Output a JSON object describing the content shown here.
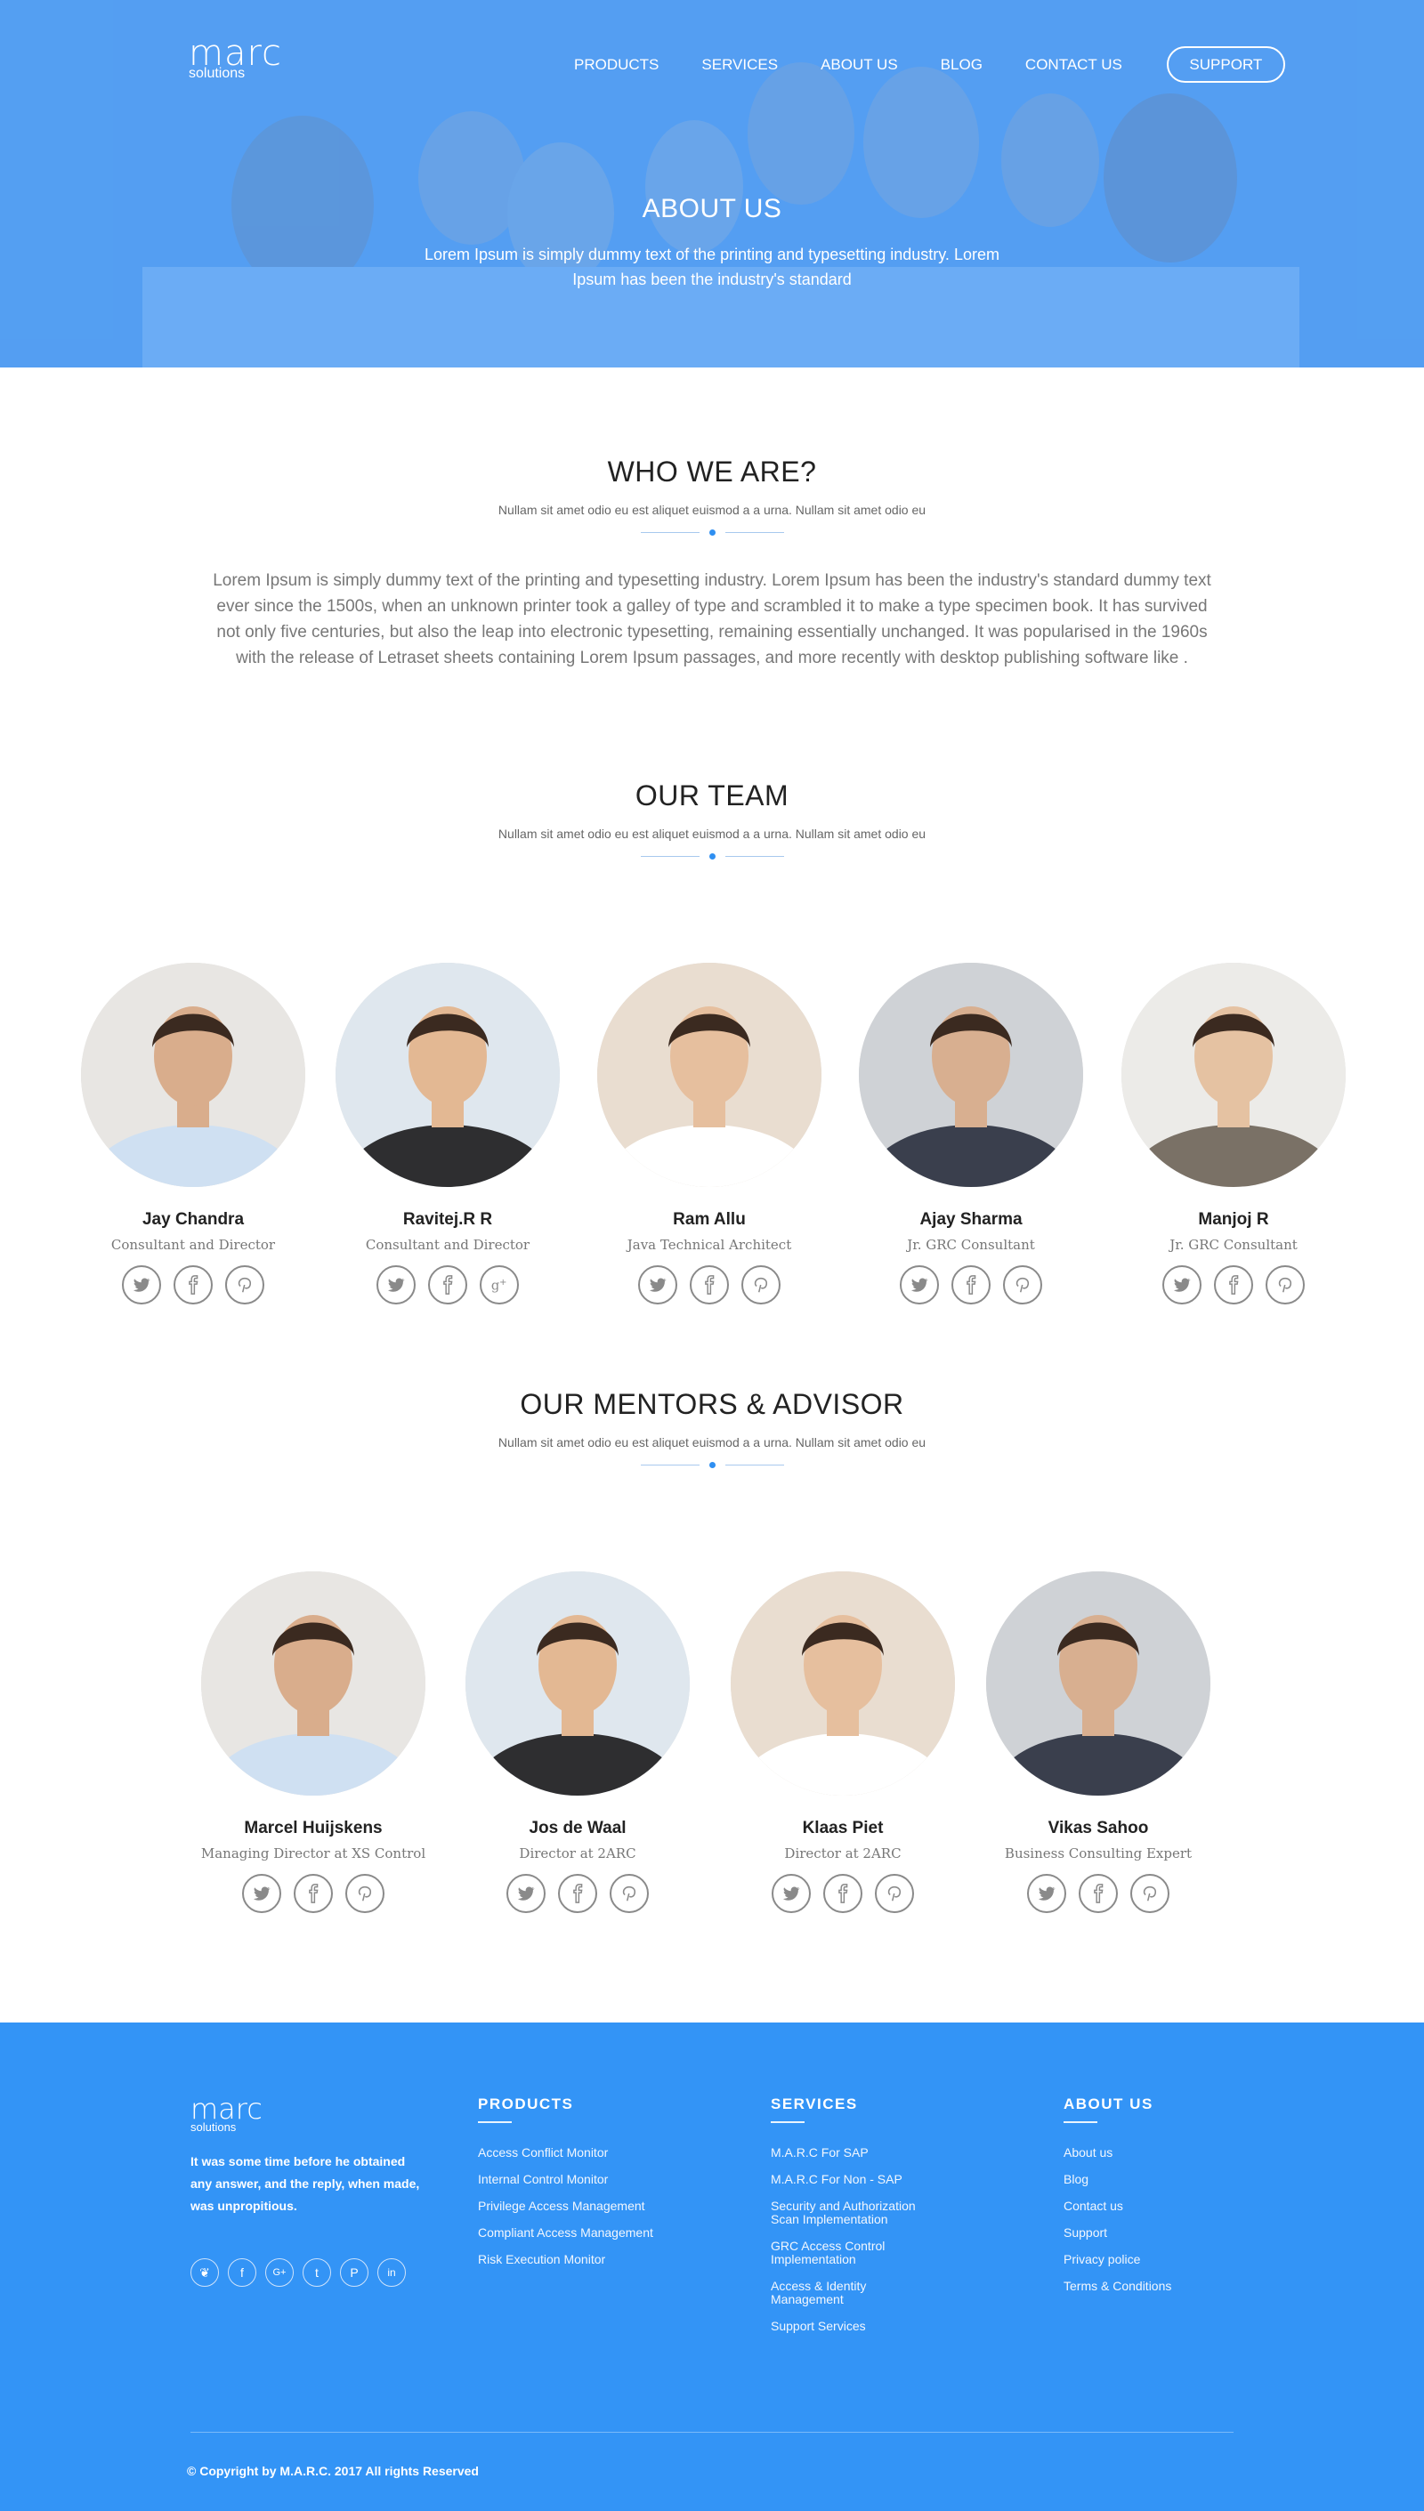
{
  "header": {
    "logo_word": "marc",
    "logo_sub": "solutions",
    "nav": [
      "PRODUCTS",
      "SERVICES",
      "ABOUT US",
      "BLOG",
      "CONTACT US"
    ],
    "support_label": "SUPPORT"
  },
  "hero": {
    "title": "ABOUT US",
    "subtitle": "Lorem Ipsum is simply dummy text of the printing and typesetting industry. Lorem Ipsum has been the industry's standard"
  },
  "who": {
    "title": "WHO WE ARE?",
    "tagline": "Nullam sit amet odio eu est aliquet euismod a a urna. Nullam sit amet odio eu",
    "body": "Lorem Ipsum is simply dummy text of the printing and typesetting industry. Lorem Ipsum has been the industry's standard dummy text ever since the 1500s, when an unknown printer took a galley of type and scrambled it to make a type specimen book. It has survived not only five centuries, but also the leap into electronic typesetting, remaining essentially unchanged. It was popularised in the 1960s with the release of Letraset sheets containing Lorem Ipsum passages, and more recently with desktop publishing software like ."
  },
  "team": {
    "title": "OUR TEAM",
    "tagline": "Nullam sit amet odio eu est aliquet euismod a a urna. Nullam sit amet odio eu",
    "members": [
      {
        "name": "Jay Chandra",
        "role": "Consultant and Director",
        "socials": [
          "twitter",
          "facebook",
          "pinterest"
        ]
      },
      {
        "name": "Ravitej.R R",
        "role": "Consultant and Director",
        "socials": [
          "twitter",
          "facebook",
          "google-plus"
        ]
      },
      {
        "name": "Ram Allu",
        "role": "Java Technical Architect",
        "socials": [
          "twitter",
          "facebook",
          "pinterest"
        ]
      },
      {
        "name": "Ajay Sharma",
        "role": "Jr. GRC Consultant",
        "socials": [
          "twitter",
          "facebook",
          "pinterest"
        ]
      },
      {
        "name": "Manjoj R",
        "role": "Jr. GRC Consultant",
        "socials": [
          "twitter",
          "facebook",
          "pinterest"
        ]
      }
    ]
  },
  "mentors": {
    "title": "OUR MENTORS & ADVISOR",
    "tagline": "Nullam sit amet odio eu est aliquet euismod a a urna. Nullam sit amet odio eu",
    "members": [
      {
        "name": "Marcel Huijskens",
        "role": "Managing Director at XS Control",
        "socials": [
          "twitter",
          "facebook",
          "pinterest"
        ]
      },
      {
        "name": "Jos de Waal",
        "role": "Director at 2ARC",
        "socials": [
          "twitter",
          "facebook",
          "pinterest"
        ]
      },
      {
        "name": "Klaas Piet",
        "role": "Director at 2ARC",
        "socials": [
          "twitter",
          "facebook",
          "pinterest"
        ]
      },
      {
        "name": "Vikas Sahoo",
        "role": "Business Consulting Expert",
        "socials": [
          "twitter",
          "facebook",
          "pinterest"
        ]
      }
    ]
  },
  "footer": {
    "logo_word": "marc",
    "logo_sub": "solutions",
    "about_text": "It was some time before he obtained any answer, and the reply, when made, was unpropitious.",
    "social_glyphs": [
      "❦",
      "f",
      "G+",
      "t",
      "P",
      "in"
    ],
    "products": {
      "title": "PRODUCTS",
      "items": [
        "Access Conflict Monitor",
        "Internal Control Monitor",
        "Privilege Access Management",
        "Compliant Access Management",
        "Risk Execution Monitor"
      ]
    },
    "services": {
      "title": "SERVICES",
      "items": [
        "M.A.R.C For SAP",
        "M.A.R.C For Non - SAP",
        "Security and Authorization Scan Implementation",
        "GRC Access Control Implementation",
        "Access & Identity Management",
        "Support Services"
      ]
    },
    "about": {
      "title": "ABOUT US",
      "items": [
        "About us",
        "Blog",
        "Contact us",
        "Support",
        "Privacy police",
        "Terms & Conditions"
      ]
    },
    "copyright": "© Copyright by M.A.R.C. 2017 All rights Reserved"
  },
  "colors": {
    "primary": "#3394f6",
    "hero_overlay": "#4f9ff4",
    "accent_dot": "#2f8ff1"
  }
}
